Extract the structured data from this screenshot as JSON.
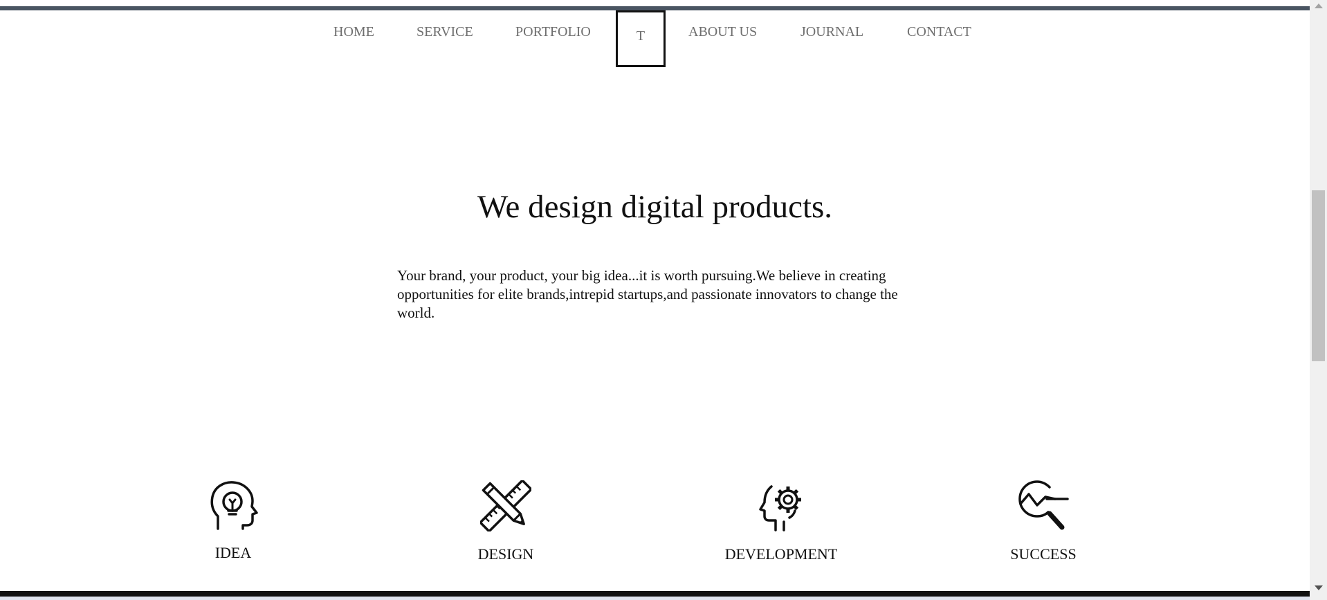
{
  "nav": {
    "items": [
      {
        "label": "HOME"
      },
      {
        "label": "SERVICE"
      },
      {
        "label": "PORTFOLIO"
      },
      {
        "label": "T"
      },
      {
        "label": "ABOUT US"
      },
      {
        "label": "JOURNAL"
      },
      {
        "label": "CONTACT"
      }
    ]
  },
  "hero": {
    "headline": "We design digital products.",
    "intro": "Your brand, your product, your big idea...it is worth pursuing.We believe in creating opportunities for elite brands,intrepid startups,and passionate innovators to change the world."
  },
  "features": [
    {
      "label": "IDEA",
      "icon": "lightbulb-head-icon"
    },
    {
      "label": "DESIGN",
      "icon": "pencil-ruler-icon"
    },
    {
      "label": "DEVELOPMENT",
      "icon": "gear-head-icon"
    },
    {
      "label": "SUCCESS",
      "icon": "chart-magnifier-icon"
    }
  ],
  "colors": {
    "top_bar": "#4a5562",
    "nav_text": "#6f6f6f",
    "text": "#111111",
    "bottom_bar": "#111111"
  }
}
